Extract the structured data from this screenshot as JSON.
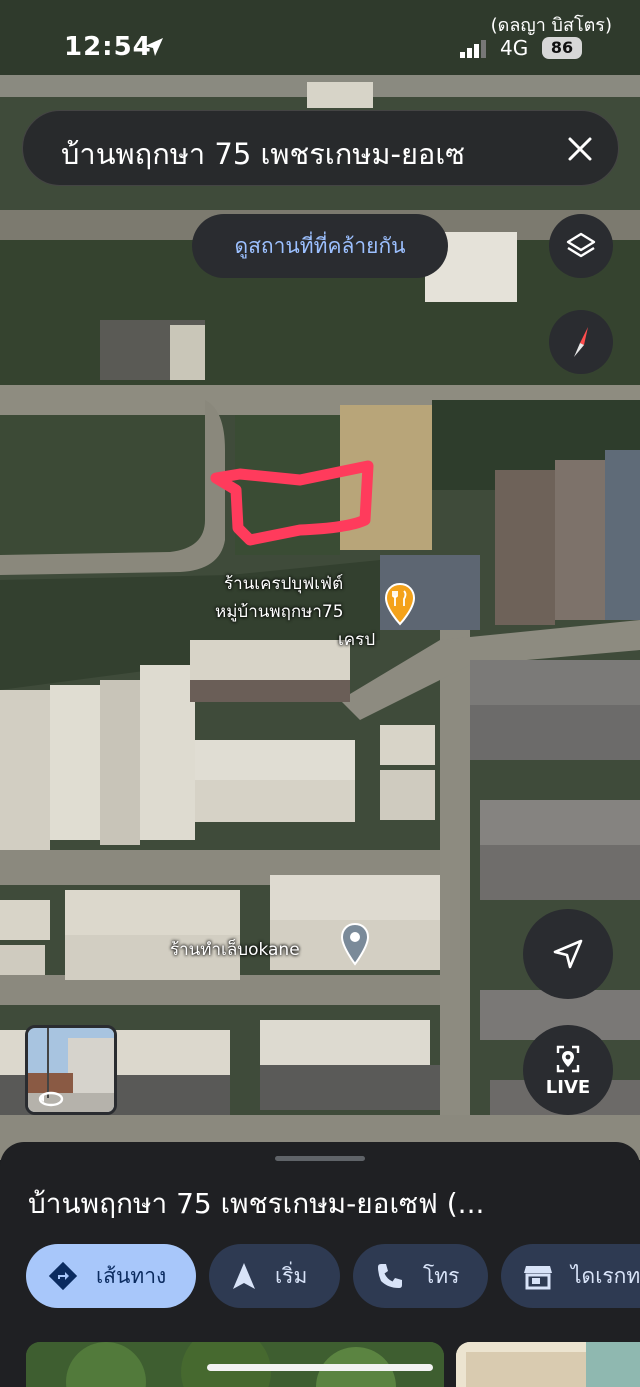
{
  "status_bar": {
    "time": "12:54",
    "carrier_top": "(ดลญา บิสโตร)",
    "network": "4G",
    "battery": "86"
  },
  "search": {
    "query": "บ้านพฤกษา 75 เพชรเกษม-ยอเซ"
  },
  "map": {
    "similar_places_button": "ดูสถานที่ที่คล้ายกัน",
    "poi_restaurant_line1": "ร้านเครปบุฟเฟ่ต์",
    "poi_restaurant_line2": "หมู่บ้านพฤกษา75",
    "poi_restaurant_line3": "เครป",
    "poi_shop": "ร้านทำเล็บokane",
    "live_label": "LIVE",
    "marker_color": "#ff3b5c",
    "poi_food_color": "#f4a21a"
  },
  "sheet": {
    "place_title": "บ้านพฤกษา 75 เพชรเกษม-ยอเซฟ (...",
    "actions": {
      "directions": "เส้นทาง",
      "start": "เริ่ม",
      "call": "โทร",
      "saved": "ไดเรกท"
    }
  },
  "icons": [
    "navigation-arrow-icon",
    "close-icon",
    "layers-icon",
    "compass-icon",
    "my-location-arrow-icon",
    "live-view-icon",
    "directions-icon",
    "start-navigation-icon",
    "phone-icon",
    "storefront-icon",
    "fork-knife-icon",
    "map-pin-icon",
    "rotate-360-icon"
  ]
}
